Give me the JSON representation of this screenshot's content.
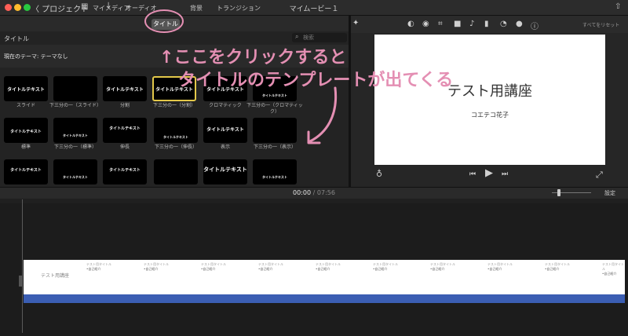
{
  "window": {
    "title": "マイムービー１",
    "back_label": "〈 プロジェクト"
  },
  "browser": {
    "tabs": [
      "マイメディア",
      "オーディオ",
      "タイトル",
      "背景",
      "トランジション"
    ],
    "section_label": "タイトル",
    "search_placeholder": "検索",
    "theme_label": "現在のテーマ: テーマなし",
    "thumbnails": [
      {
        "text": "タイトルテキスト",
        "caption": "スライド"
      },
      {
        "text": "",
        "caption": "下三分の一（スライド）"
      },
      {
        "text": "タイトルテキスト",
        "caption": "分割"
      },
      {
        "text": "タイトルテキスト",
        "caption": "下三分の一（分割）"
      },
      {
        "text": "タイトルテキスト",
        "caption": "クロマティック"
      },
      {
        "text": "タイトルテキスト",
        "caption": "下三分の一（クロマティック）"
      },
      {
        "text": "タイトルテキスト",
        "caption": "標準"
      },
      {
        "text": "タイトルテキスト",
        "caption": "下三分の一（標準）"
      },
      {
        "text": "タイトルテキスト",
        "caption": "伸長"
      },
      {
        "text": "タイトルテキスト",
        "caption": "下三分の一（伸長）"
      },
      {
        "text": "タイトルテキスト",
        "caption": "表示"
      },
      {
        "text": "",
        "caption": "下三分の一（表示）"
      },
      {
        "text": "タイトルテキスト",
        "caption": ""
      },
      {
        "text": "タイトルテキスト",
        "caption": ""
      },
      {
        "text": "タイトルテキスト",
        "caption": ""
      },
      {
        "text": "",
        "caption": ""
      },
      {
        "text": "タイトルテキスト",
        "caption": ""
      },
      {
        "text": "タイトルテキスト",
        "caption": ""
      }
    ]
  },
  "viewer": {
    "reset_label": "すべてをリセット",
    "preview_title": "テスト用講座",
    "preview_subtitle": "コエテコ花子"
  },
  "timeline": {
    "current_time": "00:00",
    "separator": "/",
    "total_time": "07:56",
    "settings_label": "設定",
    "clip_title": "テスト用講座",
    "segments": [
      "テスト用タイトル",
      "テスト用タイトル",
      "テスト用タイトル",
      "テスト用タイトル",
      "テスト用タイトル",
      "テスト用タイトル",
      "テスト用タイトル",
      "テスト用タイトル",
      "テスト用タイトル",
      "テスト用タイトル"
    ],
    "segment_sub": "•自己紹介"
  },
  "annotation": {
    "line1": "↑ここをクリックすると",
    "line2": "タイトルのテンプレートが出てくる",
    "color": "#e48fb3"
  }
}
